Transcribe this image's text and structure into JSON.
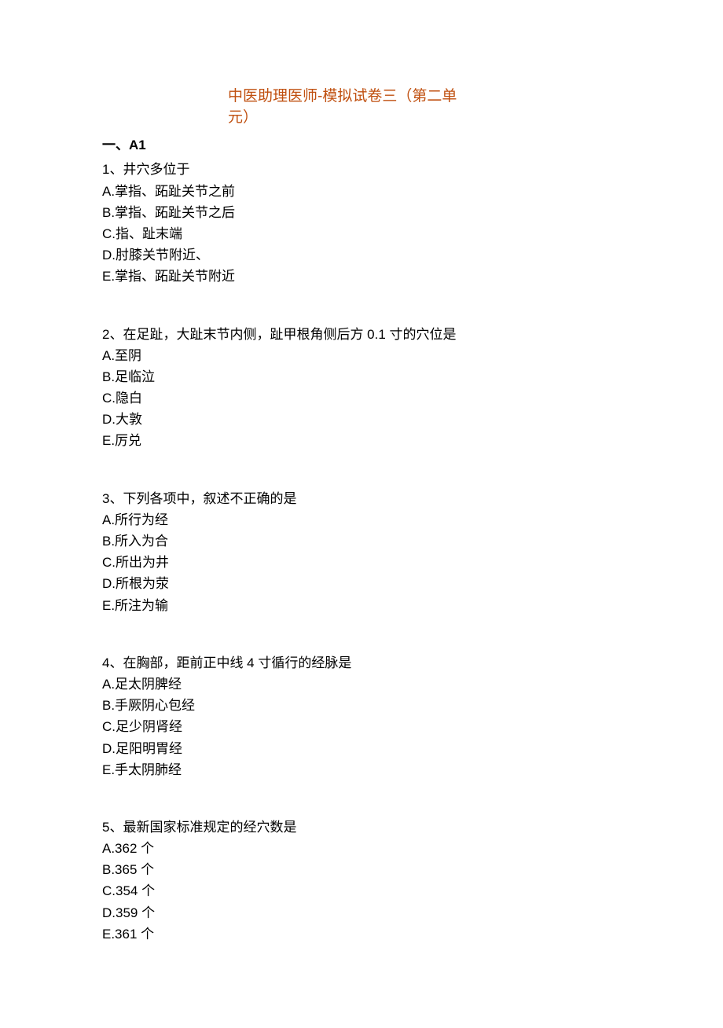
{
  "title": "中医助理医师-模拟试卷三（第二单元）",
  "section_heading": "一、A1",
  "questions": [
    {
      "stem": "1、井穴多位于",
      "opts": [
        "A.掌指、跖趾关节之前",
        "B.掌指、跖趾关节之后",
        "C.指、趾末端",
        "D.肘膝关节附近、",
        "E.掌指、跖趾关节附近"
      ]
    },
    {
      "stem": "2、在足趾，大趾末节内侧，趾甲根角侧后方 0.1 寸的穴位是",
      "opts": [
        "A.至阴",
        "B.足临泣",
        "C.隐白",
        "D.大敦",
        "E.厉兑"
      ]
    },
    {
      "stem": "3、下列各项中，叙述不正确的是",
      "opts": [
        "A.所行为经",
        "B.所入为合",
        "C.所出为井",
        "D.所根为荥",
        "E.所注为输"
      ]
    },
    {
      "stem": "4、在胸部，距前正中线 4 寸循行的经脉是",
      "opts": [
        "A.足太阴脾经",
        "B.手厥阴心包经",
        "C.足少阴肾经",
        "D.足阳明胃经",
        "E.手太阴肺经"
      ]
    },
    {
      "stem": "5、最新国家标准规定的经穴数是",
      "opts": [
        "A.362 个",
        "B.365 个",
        "C.354 个",
        "D.359 个",
        "E.361 个"
      ]
    }
  ]
}
